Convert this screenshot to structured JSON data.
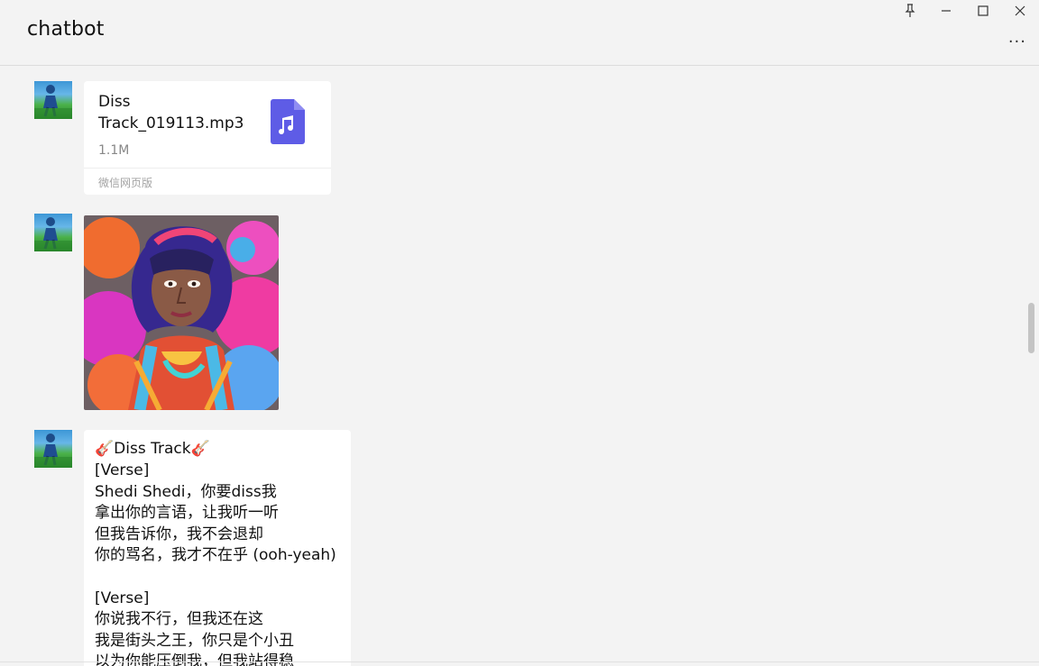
{
  "window": {
    "title": "chatbot",
    "controls": [
      "pin-icon",
      "minimize-icon",
      "maximize-icon",
      "close-icon"
    ],
    "more_label": "···"
  },
  "messages": {
    "file": {
      "name": "Diss Track_019113.mp3",
      "size": "1.1M",
      "source": "微信网页版",
      "icon": "music-file-icon",
      "icon_color": "#5e5ce6"
    },
    "image": {
      "subject": "graffiti portrait illustration"
    },
    "text": {
      "lines": [
        "🎸Diss Track🎸",
        "[Verse]",
        "Shedi Shedi，你要diss我",
        "拿出你的言语，让我听一听",
        "但我告诉你，我不会退却",
        "你的骂名，我才不在乎 (ooh-yeah)",
        "",
        "[Verse]",
        "你说我不行，但我还在这",
        "我是街头之王，你只是个小丑",
        "以为你能压倒我，但我站得稳"
      ]
    }
  },
  "colors": {
    "background": "#f3f3f3",
    "bubble": "#ffffff",
    "accent": "#5e5ce6"
  }
}
